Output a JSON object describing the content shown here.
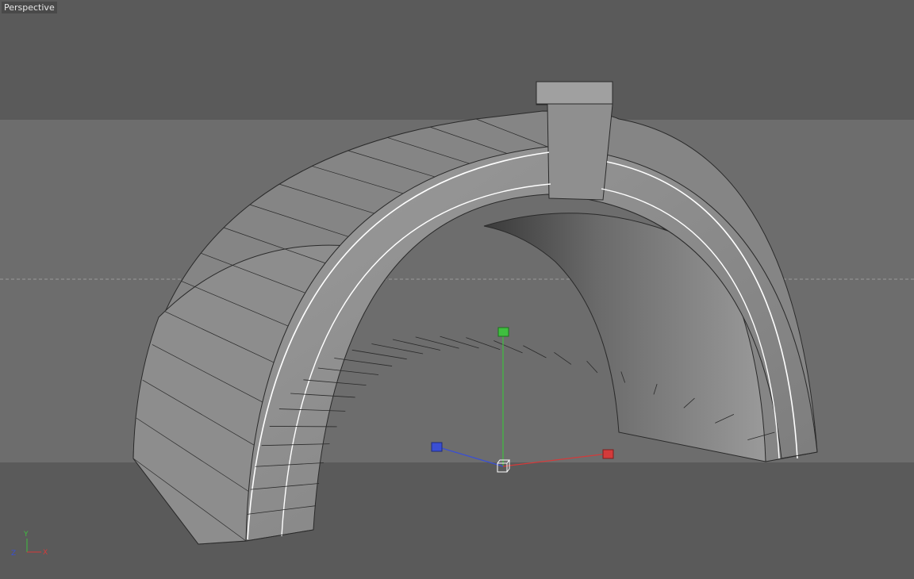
{
  "viewport": {
    "view_label": "Perspective",
    "colors": {
      "background_dark": "#5a5a5a",
      "background_band": "#6d6d6d",
      "model_gray": "#8a8a8a",
      "wire": "#2a2a2a",
      "highlight": "#ffffff",
      "axis_x": "#d43a3a",
      "axis_y": "#3fbf3f",
      "axis_z": "#3a4fd4"
    }
  },
  "gizmo": {
    "x_handle_icon": "red-cube-handle",
    "y_handle_icon": "green-cube-handle",
    "z_handle_icon": "blue-cube-handle",
    "center_icon": "white-cube-center"
  },
  "axis_indicator": {
    "y_label": "Y",
    "x_label": "X",
    "z_label": "Z"
  }
}
